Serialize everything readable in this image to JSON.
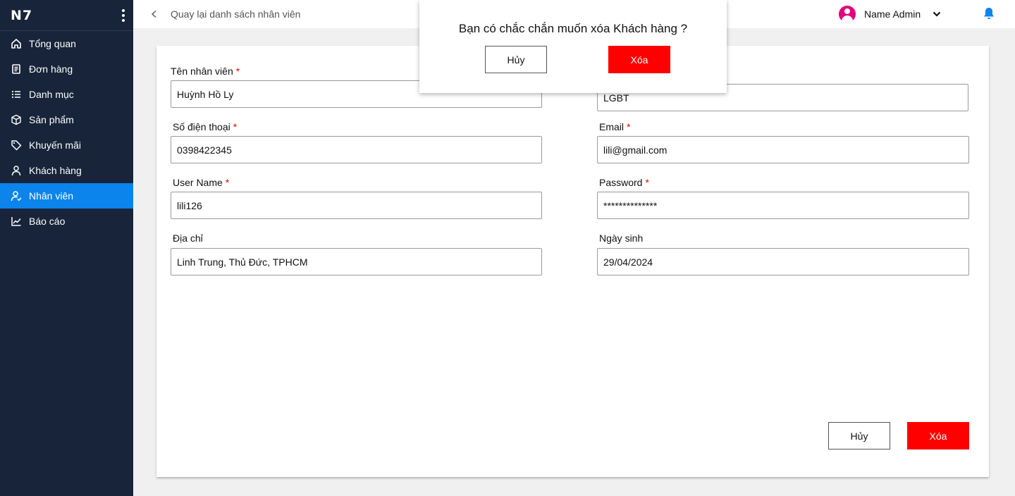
{
  "sidebar": {
    "brand": "N7",
    "items": [
      {
        "label": "Tổng quan",
        "icon": "home-icon"
      },
      {
        "label": "Đơn hàng",
        "icon": "receipt-icon"
      },
      {
        "label": "Danh mục",
        "icon": "list-icon"
      },
      {
        "label": "Sản phẩm",
        "icon": "box-icon"
      },
      {
        "label": "Khuyến mãi",
        "icon": "tag-icon"
      },
      {
        "label": "Khách hàng",
        "icon": "user-icon"
      },
      {
        "label": "Nhân viên",
        "icon": "user-check-icon",
        "active": true
      },
      {
        "label": "Báo cáo",
        "icon": "chart-icon"
      }
    ],
    "active_color": "#0b84ec",
    "bg_color": "#172439"
  },
  "topbar": {
    "back_label": "Quay lại danh sách nhân viên",
    "user_name": "Name Admin",
    "avatar_color": "#e3007a",
    "bell_color": "#0b84ec"
  },
  "form": {
    "name": {
      "label": "Tên nhân viên",
      "required": "*",
      "value": "Huỳnh Hồ Ly"
    },
    "gender": {
      "value": "LGBT"
    },
    "phone": {
      "label": "Số điện thoại",
      "required": "*",
      "value": "0398422345"
    },
    "email": {
      "label": "Email",
      "required": "*",
      "value": "lili@gmail.com"
    },
    "username": {
      "label": "User Name",
      "required": "*",
      "value": "lili126"
    },
    "password": {
      "label": "Password",
      "required": "*",
      "value": "**************"
    },
    "address": {
      "label": "Địa chỉ",
      "value": "Linh Trung, Thủ Đức, TPHCM"
    },
    "birthday": {
      "label": "Ngày sinh",
      "value": "29/04/2024"
    }
  },
  "actions": {
    "cancel_label": "Hủy",
    "delete_label": "Xóa",
    "danger_color": "#ff0000"
  },
  "modal": {
    "message": "Bạn có chắc chắn muốn xóa Khách hàng ?",
    "cancel_label": "Hủy",
    "confirm_label": "Xóa"
  }
}
